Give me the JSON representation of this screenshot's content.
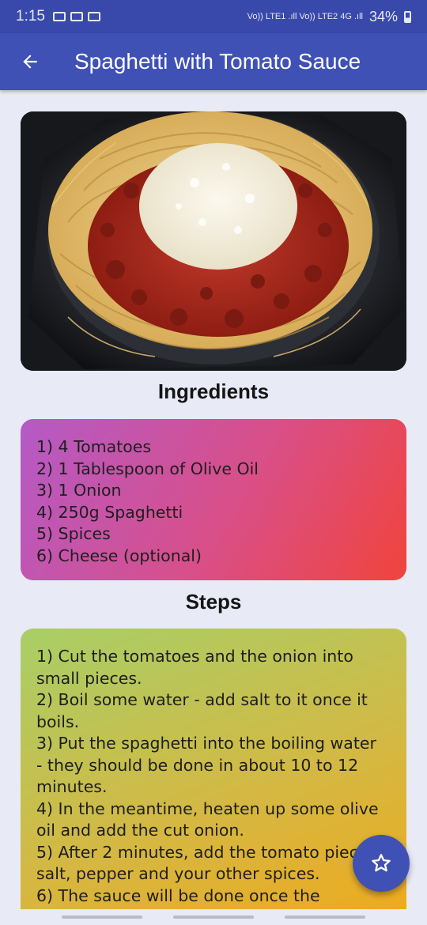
{
  "status_bar": {
    "time": "1:15",
    "network": "Vo)) LTE1 .ıll Vo)) LTE2 4G .ıll",
    "battery": "34%"
  },
  "app_bar": {
    "title": "Spaghetti with Tomato Sauce",
    "back_icon": "arrow-back-icon"
  },
  "recipe": {
    "photo": "spaghetti-bolognese-with-cheese",
    "ingredients_heading": "Ingredients",
    "ingredients": [
      "1) 4 Tomatoes",
      "2) 1 Tablespoon of Olive Oil",
      "3) 1 Onion",
      "4) 250g Spaghetti",
      "5) Spices",
      "6) Cheese (optional)"
    ],
    "steps_heading": "Steps",
    "steps_lines": [
      "1) Cut the tomatoes and the onion into",
      "small pieces.",
      "2) Boil some water - add salt to it once it",
      "boils.",
      "3) Put the spaghetti into the boiling water",
      "- they should be done in about 10 to 12",
      "minutes.",
      "4) In the meantime, heaten up some olive",
      "oil and add the cut onion.",
      "5) After 2 minutes, add the tomato pieces,",
      "salt, pepper and your other spices.",
      "6) The sauce will be done once the"
    ]
  },
  "fab": {
    "icon": "star-outline-icon"
  },
  "colors": {
    "primary": "#3f51b5",
    "status_bar": "#3949ab",
    "background": "#e8eaf6"
  }
}
